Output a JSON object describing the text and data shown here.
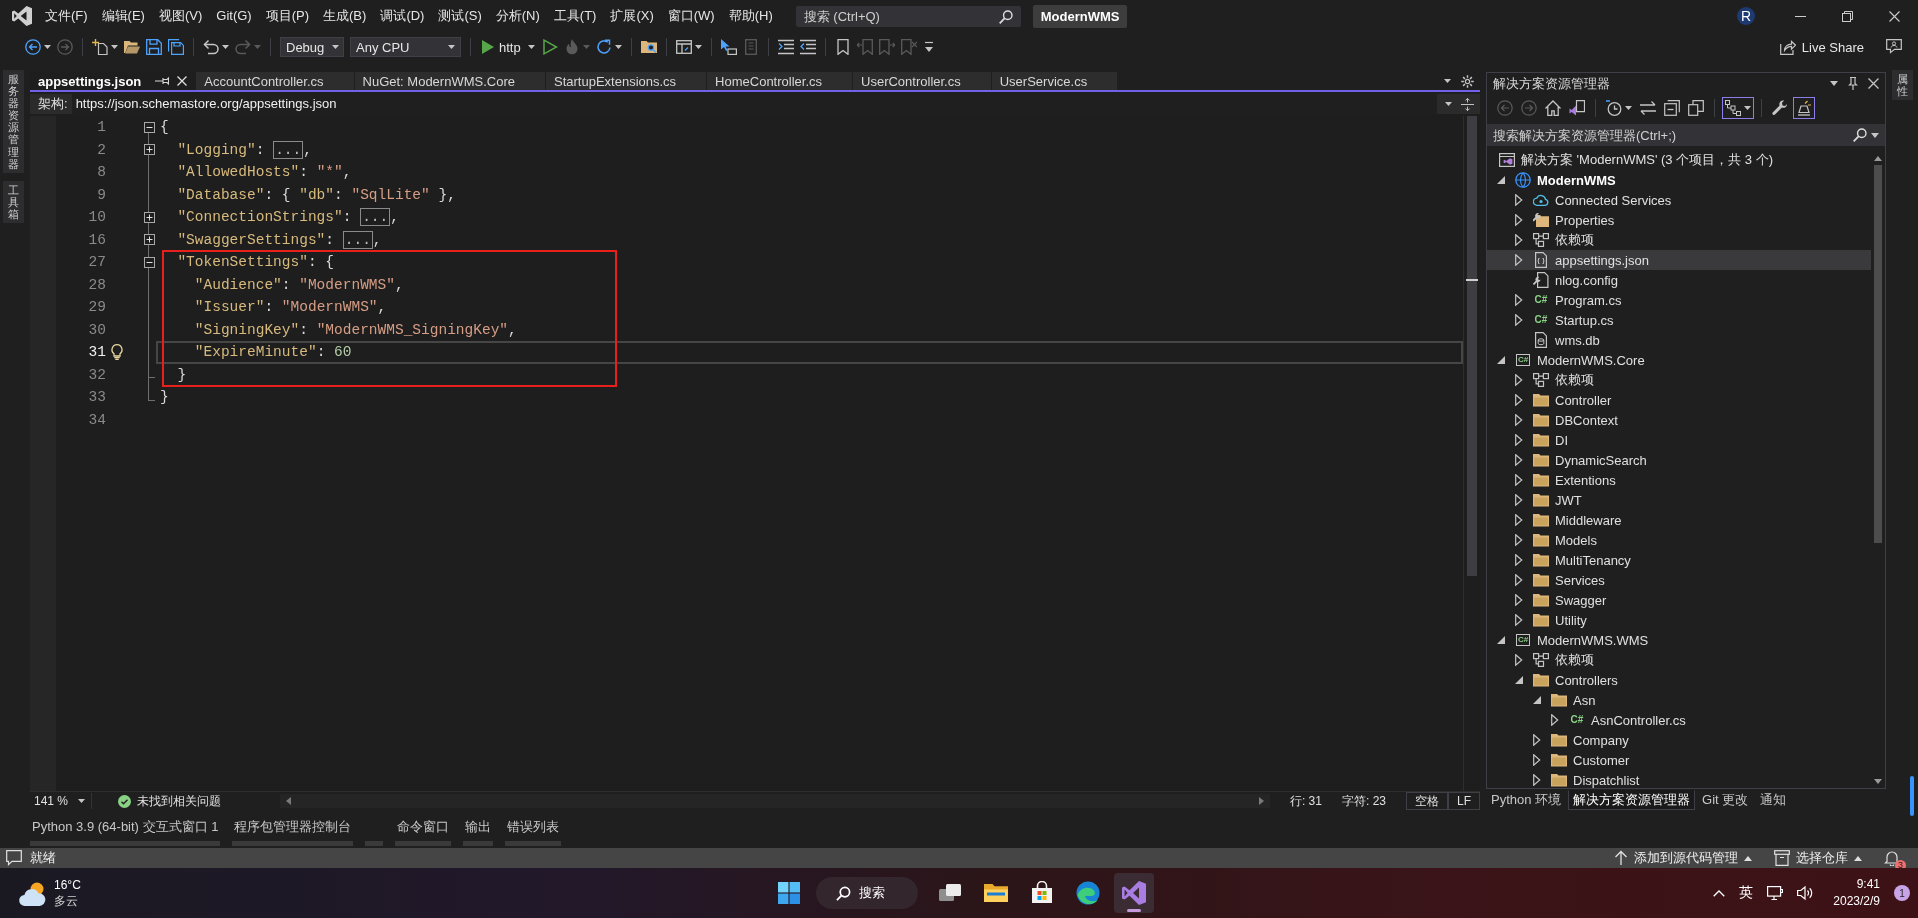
{
  "title_bar": {
    "menu": [
      "文件(F)",
      "编辑(E)",
      "视图(V)",
      "Git(G)",
      "项目(P)",
      "生成(B)",
      "调试(D)",
      "测试(S)",
      "分析(N)",
      "工具(T)",
      "扩展(X)",
      "窗口(W)",
      "帮助(H)"
    ],
    "search": {
      "placeholder": "搜索 (Ctrl+Q)"
    },
    "title": "ModernWMS",
    "account": "R"
  },
  "toolbar": {
    "groups": [
      [
        {
          "kind": "back",
          "disabled": false
        },
        {
          "kind": "forward",
          "disabled": true
        }
      ],
      [
        {
          "kind": "newitem",
          "disabled": false
        },
        {
          "kind": "open",
          "disabled": false
        },
        {
          "kind": "save",
          "disabled": false
        },
        {
          "kind": "saveall",
          "disabled": false
        }
      ],
      [
        {
          "kind": "undo",
          "disabled": false
        },
        {
          "kind": "redo",
          "disabled": true
        }
      ],
      [
        {
          "kind": "configuration",
          "label": "Debug",
          "disabled": false
        },
        {
          "kind": "platform",
          "label": "Any CPU",
          "disabled": false
        }
      ],
      [
        {
          "kind": "start",
          "label": "http",
          "disabled": false
        },
        {
          "kind": "startnodebug",
          "disabled": false
        },
        {
          "kind": "hotreload",
          "disabled": true
        },
        {
          "kind": "restart",
          "disabled": false
        }
      ],
      [
        {
          "kind": "openfolder",
          "disabled": false
        }
      ],
      [
        {
          "kind": "layout",
          "disabled": false
        }
      ],
      [
        {
          "kind": "pointer",
          "disabled": false
        },
        {
          "kind": "panel",
          "disabled": true
        }
      ],
      [
        {
          "kind": "comment",
          "disabled": false
        },
        {
          "kind": "uncomment",
          "disabled": false
        }
      ],
      [
        {
          "kind": "bookmark",
          "disabled": false
        },
        {
          "kind": "prevbookmark",
          "disabled": true
        },
        {
          "kind": "nextbookmark",
          "disabled": true
        },
        {
          "kind": "clearbookmarks",
          "disabled": true
        },
        {
          "kind": "overflow",
          "disabled": false
        }
      ]
    ],
    "live_share": "Live Share"
  },
  "left_dock": [
    "服务器资源管理器",
    "工具箱"
  ],
  "right_dock": [
    "属性"
  ],
  "editor": {
    "tabs": [
      {
        "label": "appsettings.json",
        "selected": true
      },
      {
        "label": "AccountController.cs",
        "selected": false
      },
      {
        "label": "NuGet: ModernWMS.Core",
        "selected": false
      },
      {
        "label": "StartupExtensions.cs",
        "selected": false
      },
      {
        "label": "HomeController.cs",
        "selected": false
      },
      {
        "label": "UserController.cs",
        "selected": false
      },
      {
        "label": "UserService.cs",
        "selected": false
      }
    ],
    "schema": {
      "label": "架构:",
      "value": "https://json.schemastore.org/appsettings.json"
    },
    "lines": [
      {
        "number": "1",
        "expanded": true,
        "current": false,
        "boxed": false,
        "tokens": [
          {
            "kind": "punct",
            "text": "{"
          }
        ],
        "children": [
          {
            "number": "2",
            "expanded": false,
            "current": false,
            "boxed": false,
            "tokens": [
              {
                "kind": "key",
                "text": "\"Logging\""
              },
              {
                "kind": "punct",
                "text": ": "
              },
              {
                "kind": "collapsed",
                "text": "..."
              },
              {
                "kind": "punct",
                "text": ","
              }
            ]
          },
          {
            "number": "8",
            "current": false,
            "boxed": false,
            "tokens": [
              {
                "kind": "key",
                "text": "\"AllowedHosts\""
              },
              {
                "kind": "punct",
                "text": ": "
              },
              {
                "kind": "string",
                "text": "\"*\""
              },
              {
                "kind": "punct",
                "text": ","
              }
            ]
          },
          {
            "number": "9",
            "current": false,
            "boxed": false,
            "tokens": [
              {
                "kind": "key",
                "text": "\"Database\""
              },
              {
                "kind": "punct",
                "text": ": { "
              },
              {
                "kind": "key",
                "text": "\"db\""
              },
              {
                "kind": "punct",
                "text": ": "
              },
              {
                "kind": "string",
                "text": "\"SqlLite\""
              },
              {
                "kind": "punct",
                "text": " },"
              }
            ]
          },
          {
            "number": "10",
            "expanded": false,
            "current": false,
            "boxed": false,
            "tokens": [
              {
                "kind": "key",
                "text": "\"ConnectionStrings\""
              },
              {
                "kind": "punct",
                "text": ": "
              },
              {
                "kind": "collapsed",
                "text": "..."
              },
              {
                "kind": "punct",
                "text": ","
              }
            ]
          },
          {
            "number": "16",
            "expanded": false,
            "current": false,
            "boxed": false,
            "tokens": [
              {
                "kind": "key",
                "text": "\"SwaggerSettings\""
              },
              {
                "kind": "punct",
                "text": ": "
              },
              {
                "kind": "collapsed",
                "text": "..."
              },
              {
                "kind": "punct",
                "text": ","
              }
            ]
          },
          {
            "number": "27",
            "expanded": true,
            "current": false,
            "boxed": true,
            "tokens": [
              {
                "kind": "key",
                "text": "\"TokenSettings\""
              },
              {
                "kind": "punct",
                "text": ": {"
              }
            ],
            "children": [
              {
                "number": "28",
                "current": false,
                "boxed": false,
                "tokens": [
                  {
                    "kind": "key",
                    "text": "\"Audience\""
                  },
                  {
                    "kind": "punct",
                    "text": ": "
                  },
                  {
                    "kind": "string",
                    "text": "\"ModernWMS\""
                  },
                  {
                    "kind": "punct",
                    "text": ","
                  }
                ]
              },
              {
                "number": "29",
                "current": false,
                "boxed": false,
                "tokens": [
                  {
                    "kind": "key",
                    "text": "\"Issuer\""
                  },
                  {
                    "kind": "punct",
                    "text": ": "
                  },
                  {
                    "kind": "string",
                    "text": "\"ModernWMS\""
                  },
                  {
                    "kind": "punct",
                    "text": ","
                  }
                ]
              },
              {
                "number": "30",
                "current": false,
                "boxed": false,
                "tokens": [
                  {
                    "kind": "key",
                    "text": "\"SigningKey\""
                  },
                  {
                    "kind": "punct",
                    "text": ": "
                  },
                  {
                    "kind": "string",
                    "text": "\"ModernWMS_SigningKey\""
                  },
                  {
                    "kind": "punct",
                    "text": ","
                  }
                ]
              },
              {
                "number": "31",
                "current": true,
                "boxed": false,
                "tokens": [
                  {
                    "kind": "key",
                    "text": "\"ExpireMinute\""
                  },
                  {
                    "kind": "punct",
                    "text": ": "
                  },
                  {
                    "kind": "number",
                    "text": "60"
                  }
                ]
              }
            ]
          },
          {
            "number": "32",
            "current": false,
            "boxed": false,
            "tokens": [
              {
                "kind": "punct",
                "text": "}"
              }
            ]
          }
        ]
      },
      {
        "number": "33",
        "current": false,
        "boxed": false,
        "tokens": [
          {
            "kind": "punct",
            "text": "}"
          }
        ]
      },
      {
        "number": "34",
        "current": false,
        "boxed": false
      }
    ],
    "footer": {
      "zoom": "141 %",
      "issues": "未找到相关问题",
      "line": "行: 31",
      "column": "字符: 23",
      "indentation": "空格",
      "line_ending": "LF"
    }
  },
  "solution_explorer": {
    "title": "解决方案资源管理器",
    "toolbar": [
      [
        {
          "kind": "back",
          "disabled": true,
          "on": false
        },
        {
          "kind": "forward",
          "disabled": true,
          "on": false
        },
        {
          "kind": "home",
          "disabled": false,
          "on": false
        },
        {
          "kind": "switchviews",
          "disabled": false,
          "on": false
        }
      ],
      [
        {
          "kind": "pending",
          "disabled": false,
          "on": false
        },
        {
          "kind": "sync",
          "disabled": false,
          "on": false
        },
        {
          "kind": "collapse",
          "disabled": false,
          "on": false
        },
        {
          "kind": "showall",
          "disabled": false,
          "on": false
        }
      ],
      [
        {
          "kind": "treeview",
          "disabled": false,
          "on": true
        }
      ],
      [
        {
          "kind": "properties",
          "disabled": false,
          "on": false
        },
        {
          "kind": "preview",
          "disabled": false,
          "on": true
        }
      ]
    ],
    "search": {
      "placeholder": "搜索解决方案资源管理器(Ctrl+;)"
    },
    "tree": [
      {
        "label": "解决方案 'ModernWMS' (3 个项目，共 3 个)",
        "kind": "solution",
        "selected": false,
        "children": [
          {
            "label": "ModernWMS",
            "kind": "webproject",
            "expanded": true,
            "selected": false,
            "startup": true,
            "children": [
              {
                "label": "Connected Services",
                "kind": "cloud",
                "expanded": false,
                "selected": false
              },
              {
                "label": "Properties",
                "kind": "properties",
                "expanded": false,
                "selected": false
              },
              {
                "label": "依赖项",
                "kind": "dependencies",
                "expanded": false,
                "selected": false
              },
              {
                "label": "appsettings.json",
                "kind": "json",
                "expanded": false,
                "selected": true
              },
              {
                "label": "nlog.config",
                "kind": "config",
                "selected": false
              },
              {
                "label": "Program.cs",
                "kind": "csharp",
                "glyph": "C#",
                "expanded": false,
                "selected": false
              },
              {
                "label": "Startup.cs",
                "kind": "csharp",
                "glyph": "C#",
                "expanded": false,
                "selected": false
              },
              {
                "label": "wms.db",
                "kind": "database",
                "selected": false
              }
            ]
          },
          {
            "label": "ModernWMS.Core",
            "kind": "csproject",
            "glyph": "C#",
            "expanded": true,
            "selected": false,
            "startup": false,
            "children": [
              {
                "label": "依赖项",
                "kind": "dependencies",
                "expanded": false,
                "selected": false
              },
              {
                "label": "Controller",
                "kind": "folder",
                "expanded": false,
                "selected": false
              },
              {
                "label": "DBContext",
                "kind": "folder",
                "expanded": false,
                "selected": false
              },
              {
                "label": "DI",
                "kind": "folder",
                "expanded": false,
                "selected": false
              },
              {
                "label": "DynamicSearch",
                "kind": "folder",
                "expanded": false,
                "selected": false
              },
              {
                "label": "Extentions",
                "kind": "folder",
                "expanded": false,
                "selected": false
              },
              {
                "label": "JWT",
                "kind": "folder",
                "expanded": false,
                "selected": false
              },
              {
                "label": "Middleware",
                "kind": "folder",
                "expanded": false,
                "selected": false
              },
              {
                "label": "Models",
                "kind": "folder",
                "expanded": false,
                "selected": false
              },
              {
                "label": "MultiTenancy",
                "kind": "folder",
                "expanded": false,
                "selected": false
              },
              {
                "label": "Services",
                "kind": "folder",
                "expanded": false,
                "selected": false
              },
              {
                "label": "Swagger",
                "kind": "folder",
                "expanded": false,
                "selected": false
              },
              {
                "label": "Utility",
                "kind": "folder",
                "expanded": false,
                "selected": false
              }
            ]
          },
          {
            "label": "ModernWMS.WMS",
            "kind": "csproject",
            "glyph": "C#",
            "expanded": true,
            "selected": false,
            "startup": false,
            "children": [
              {
                "label": "依赖项",
                "kind": "dependencies",
                "expanded": false,
                "selected": false
              },
              {
                "label": "Controllers",
                "kind": "folder",
                "expanded": true,
                "selected": false,
                "children": [
                  {
                    "label": "Asn",
                    "kind": "folder",
                    "expanded": true,
                    "selected": false,
                    "children": [
                      {
                        "label": "AsnController.cs",
                        "kind": "csharp",
                        "glyph": "C#",
                        "expanded": false,
                        "selected": false
                      }
                    ]
                  },
                  {
                    "label": "Company",
                    "kind": "folder",
                    "expanded": false,
                    "selected": false
                  },
                  {
                    "label": "Customer",
                    "kind": "folder",
                    "expanded": false,
                    "selected": false
                  },
                  {
                    "label": "Dispatchlist",
                    "kind": "folder",
                    "expanded": false,
                    "selected": false
                  }
                ]
              }
            ]
          }
        ]
      }
    ],
    "tabs": [
      {
        "label": "Python 环境",
        "selected": false
      },
      {
        "label": "解决方案资源管理器",
        "selected": true
      },
      {
        "label": "Git 更改",
        "selected": false
      },
      {
        "label": "通知",
        "selected": false
      }
    ]
  },
  "tool_tabs": [
    {
      "kind": "label",
      "label": "Python 3.9 (64-bit) 交互式窗口 1"
    },
    {
      "kind": "label",
      "label": "程序包管理器控制台"
    },
    {
      "kind": "blank"
    },
    {
      "kind": "label",
      "label": "命令窗口"
    },
    {
      "kind": "label",
      "label": "输出"
    },
    {
      "kind": "label",
      "label": "错误列表"
    }
  ],
  "status_bar": {
    "message": "就绪",
    "source_control": "添加到源代码管理",
    "repository": "选择仓库",
    "notifications": "3"
  },
  "taskbar": {
    "weather": {
      "temperature": "16°C",
      "condition": "多云"
    },
    "search": "搜索",
    "apps": [
      {
        "kind": "taskview",
        "active": false
      },
      {
        "kind": "explorer",
        "active": false
      },
      {
        "kind": "store",
        "active": false
      },
      {
        "kind": "edge",
        "active": false
      },
      {
        "kind": "visualstudio",
        "active": true
      }
    ],
    "tray": {
      "input_method": "英",
      "time": "9:41",
      "date": "2023/2/9",
      "notifications": "1"
    }
  }
}
